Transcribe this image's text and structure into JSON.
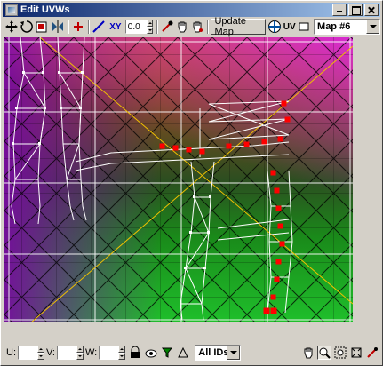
{
  "window": {
    "title": "Edit UVWs"
  },
  "toolbar": {
    "axis_label": "XY",
    "value": "0.0",
    "update_map_label": "Update Map",
    "uv_label": "UV",
    "map_select": "Map #6"
  },
  "statusbar": {
    "u_label": "U:",
    "v_label": "V:",
    "w_label": "W:",
    "u_value": "",
    "v_value": "",
    "w_value": "",
    "id_select": "All IDs"
  },
  "colors": {
    "title_start": "#0a246a",
    "title_end": "#a6caf0",
    "grid": "#ffffff",
    "selection": "#ff0000",
    "diagonal": "#f0c000"
  }
}
